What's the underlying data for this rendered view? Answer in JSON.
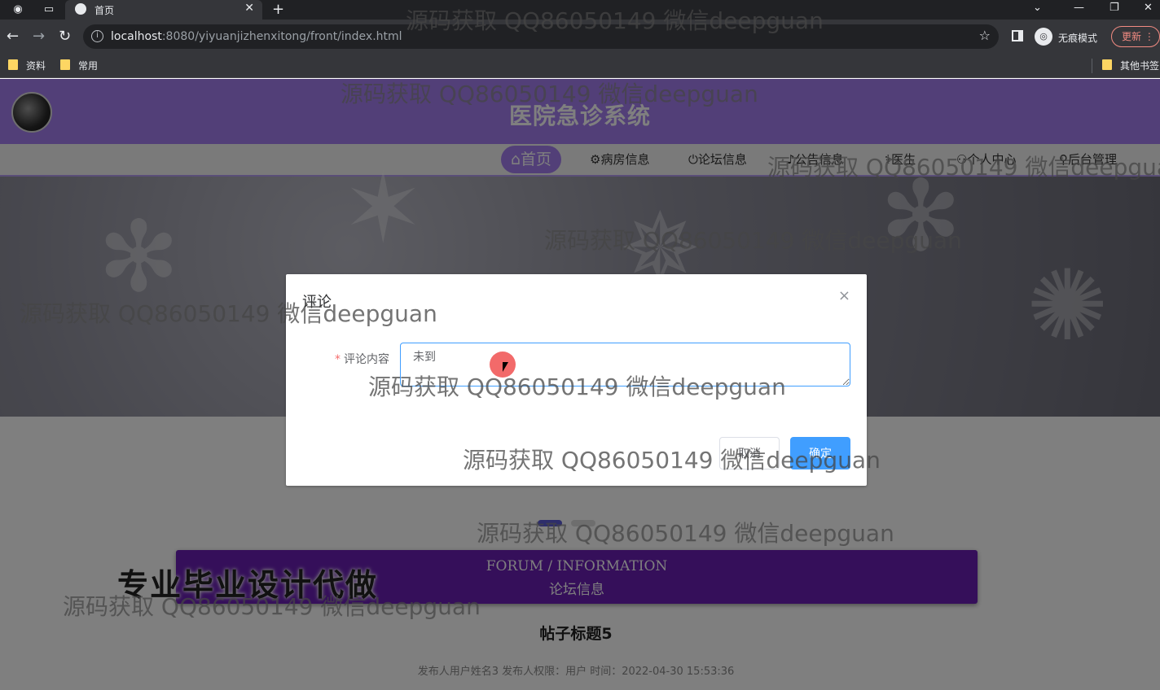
{
  "browser": {
    "tab_title": "首页",
    "url_host": "localhost",
    "url_rest": ":8080/yiyuanjizhenxitong/front/index.html",
    "incognito_label": "无痕模式",
    "update_label": "更新",
    "bookmarks": [
      "资料",
      "常用"
    ],
    "other_bookmarks": "其他书签"
  },
  "site": {
    "title": "医院急诊系统",
    "nav": [
      {
        "label": "⌂首页"
      },
      {
        "label": "⚙病房信息"
      },
      {
        "label": "⏻论坛信息"
      },
      {
        "label": "♪公告信息"
      },
      {
        "label": "⚕医生"
      },
      {
        "label": "⚇个人中心"
      },
      {
        "label": "⚲后台管理"
      }
    ]
  },
  "forum": {
    "en": "FORUM / INFORMATION",
    "zh": "论坛信息"
  },
  "post": {
    "title": "帖子标题5",
    "meta": "发布人用户姓名3   发布人权限：用户   时间：2022-04-30 15:53:36"
  },
  "promo": "专业毕业设计代做",
  "dialog": {
    "title": "评论",
    "field_label": "评论内容",
    "field_value": "未到",
    "cancel_label": "取消",
    "ok_label": "确定"
  },
  "watermark": "源码获取 QQ86050149 微信deepguan"
}
